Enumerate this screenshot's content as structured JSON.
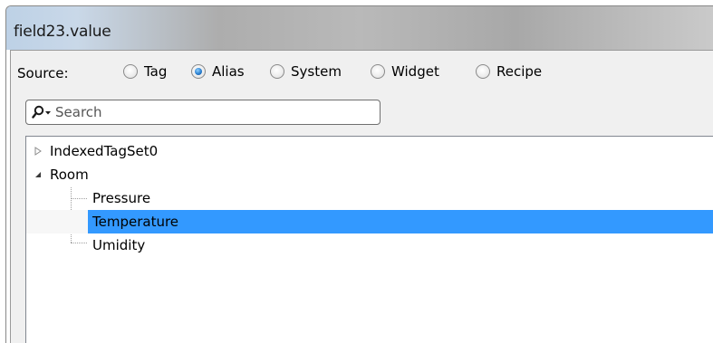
{
  "window": {
    "title": "field23.value"
  },
  "source": {
    "label": "Source:",
    "options": [
      {
        "label": "Tag",
        "checked": false
      },
      {
        "label": "Alias",
        "checked": true
      },
      {
        "label": "System",
        "checked": false
      },
      {
        "label": "Widget",
        "checked": false
      },
      {
        "label": "Recipe",
        "checked": false
      }
    ]
  },
  "search": {
    "placeholder": "Search",
    "value": "",
    "icon": "search-icon"
  },
  "tree": {
    "items": [
      {
        "label": "IndexedTagSet0",
        "expanded": false,
        "level": 0
      },
      {
        "label": "Room",
        "expanded": true,
        "level": 0
      },
      {
        "label": "Pressure",
        "level": 1
      },
      {
        "label": "Temperature",
        "level": 1,
        "selected": true
      },
      {
        "label": "Umidity",
        "level": 1
      }
    ]
  },
  "colors": {
    "selection": "#3399ff",
    "client_background": "#f0f0f0"
  }
}
